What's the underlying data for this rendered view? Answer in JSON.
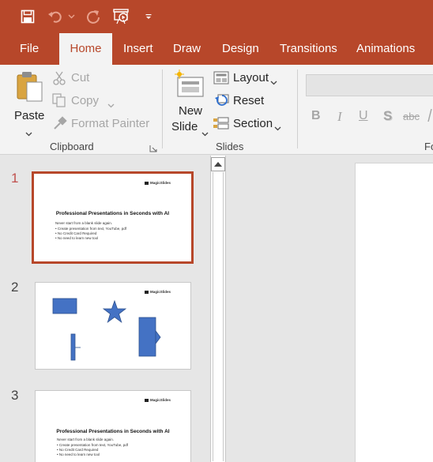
{
  "qat": {
    "icons": [
      "save-icon",
      "undo-icon",
      "redo-icon",
      "start-from-beginning-icon",
      "customize-qat-icon"
    ]
  },
  "tabs": [
    {
      "label": "File"
    },
    {
      "label": "Home"
    },
    {
      "label": "Insert"
    },
    {
      "label": "Draw"
    },
    {
      "label": "Design"
    },
    {
      "label": "Transitions"
    },
    {
      "label": "Animations"
    }
  ],
  "ribbon": {
    "clipboard": {
      "paste": "Paste",
      "cut": "Cut",
      "copy": "Copy",
      "format_painter": "Format Painter",
      "group_label": "Clipboard"
    },
    "slides": {
      "new_slide_line1": "New",
      "new_slide_line2": "Slide",
      "layout": "Layout",
      "reset": "Reset",
      "section": "Section",
      "group_label": "Slides"
    },
    "font": {
      "bold": "B",
      "italic": "I",
      "underline": "U",
      "shadow": "S",
      "strikethrough": "abc",
      "group_label_partial": "Fo"
    }
  },
  "slides": [
    {
      "number": "1",
      "selected": true,
      "logo": "MagicSlides",
      "title": "Professional Presentations in Seconds with AI",
      "subtitle": "Never start from a blank slide again.",
      "bullets": [
        "• Create presentation from text, YouTube, pdf",
        "• No Credit Card Required",
        "• No need to learn new tool"
      ]
    },
    {
      "number": "2",
      "selected": false,
      "logo": "MagicSlides",
      "shapes": [
        "rectangle",
        "star",
        "line-callout",
        "right-arrow"
      ]
    },
    {
      "number": "3",
      "selected": false,
      "logo": "MagicSlides",
      "title": "Professional Presentations in Seconds with AI",
      "subtitle": "Never start from a blank slide again.",
      "bullets": [
        "• Create presentation from text, YouTube, pdf",
        "• No Credit Card Required",
        "• No need to learn new tool"
      ]
    }
  ],
  "colors": {
    "accent": "#b7472a",
    "shape_fill": "#4472c4",
    "shape_stroke": "#2f528f"
  }
}
